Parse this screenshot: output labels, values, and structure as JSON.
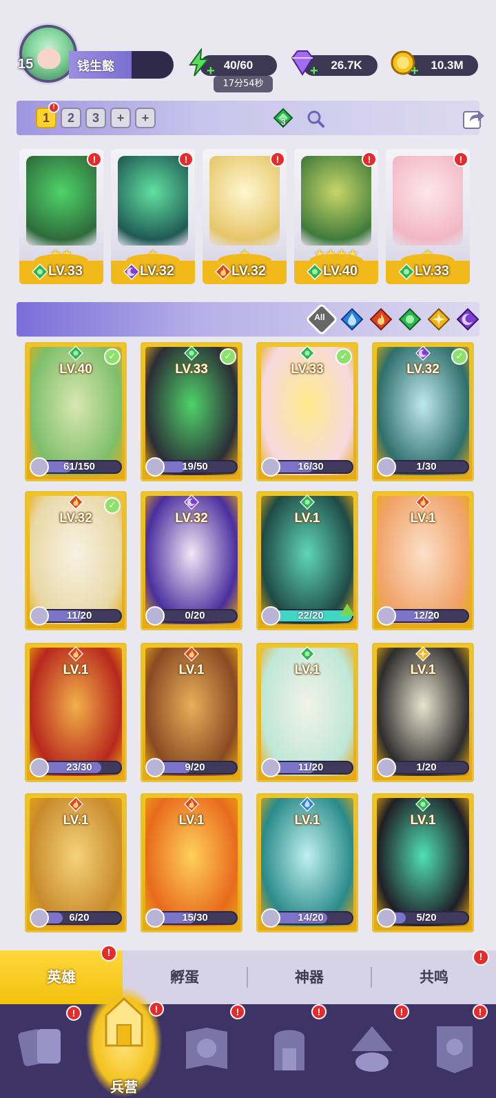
{
  "player": {
    "level": "15",
    "name": "钱生懿"
  },
  "resources": {
    "energy": "40/60",
    "energy_timer": "17分54秒",
    "gems": "26.7K",
    "coins": "10.3M"
  },
  "team_tabs": [
    "1",
    "2",
    "3",
    "+",
    "+"
  ],
  "team_gem_count": "3",
  "team_slots": [
    {
      "level": "LV.33",
      "stars": "★★",
      "element": "nature",
      "colors": [
        "#2e6b3a",
        "#4fd36a"
      ],
      "alert": "!"
    },
    {
      "level": "LV.32",
      "stars": "★",
      "element": "dark",
      "colors": [
        "#1f5a54",
        "#62e0a0"
      ],
      "alert": "!"
    },
    {
      "level": "LV.32",
      "stars": "★",
      "element": "fire",
      "colors": [
        "#e6c66a",
        "#fff6cf"
      ],
      "alert": "!"
    },
    {
      "level": "LV.40",
      "stars": "★★★★",
      "element": "nature",
      "colors": [
        "#3f7a3a",
        "#c8d66a"
      ],
      "alert": "!"
    },
    {
      "level": "LV.33",
      "stars": "★",
      "element": "nature",
      "colors": [
        "#f2b6c4",
        "#fde6ea"
      ],
      "alert": "!"
    }
  ],
  "filter_all_label": "All",
  "filters": [
    "water",
    "fire",
    "nature",
    "light",
    "dark"
  ],
  "heroes": [
    {
      "level": "LV.40",
      "shards": "61/150",
      "fill": 0.41,
      "element": "nature",
      "check": true,
      "colors": [
        "#7fbf6a",
        "#d8e7b2"
      ]
    },
    {
      "level": "LV.33",
      "shards": "19/50",
      "fill": 0.38,
      "element": "nature",
      "check": true,
      "colors": [
        "#2b2e36",
        "#4fd36a"
      ]
    },
    {
      "level": "LV.33",
      "shards": "16/30",
      "fill": 0.53,
      "element": "nature",
      "check": true,
      "colors": [
        "#f6d9e0",
        "#ffe98a"
      ]
    },
    {
      "level": "LV.32",
      "shards": "1/30",
      "fill": 0.03,
      "element": "dark",
      "check": true,
      "colors": [
        "#2f6f6a",
        "#bfe7ef"
      ]
    },
    {
      "level": "LV.32",
      "shards": "11/20",
      "fill": 0.55,
      "element": "fire",
      "check": true,
      "colors": [
        "#e9d9a8",
        "#f7f1e2"
      ]
    },
    {
      "level": "LV.32",
      "shards": "0/20",
      "fill": 0.0,
      "element": "dark",
      "check": false,
      "colors": [
        "#4a2f9e",
        "#f2e6f6"
      ]
    },
    {
      "level": "LV.1",
      "shards": "22/20",
      "fill": 1.0,
      "element": "nature",
      "check": false,
      "up": true,
      "colors": [
        "#1f4a46",
        "#5fd6b8"
      ]
    },
    {
      "level": "LV.1",
      "shards": "12/20",
      "fill": 0.6,
      "element": "fire",
      "check": false,
      "colors": [
        "#f1a36a",
        "#fbe0c8"
      ]
    },
    {
      "level": "LV.1",
      "shards": "23/30",
      "fill": 0.77,
      "element": "fire",
      "check": false,
      "colors": [
        "#b8281d",
        "#f1b04a"
      ]
    },
    {
      "level": "LV.1",
      "shards": "9/20",
      "fill": 0.45,
      "element": "fire",
      "check": false,
      "colors": [
        "#8a4a23",
        "#e7b05a"
      ]
    },
    {
      "level": "LV.1",
      "shards": "11/20",
      "fill": 0.55,
      "element": "nature",
      "check": false,
      "colors": [
        "#bfe7d8",
        "#f2f2e7"
      ]
    },
    {
      "level": "LV.1",
      "shards": "1/20",
      "fill": 0.05,
      "element": "light",
      "check": false,
      "colors": [
        "#2d2d2d",
        "#e9e3cf"
      ]
    },
    {
      "level": "LV.1",
      "shards": "6/20",
      "fill": 0.3,
      "element": "fire",
      "check": false,
      "colors": [
        "#c98b2c",
        "#f5d27a"
      ]
    },
    {
      "level": "LV.1",
      "shards": "15/30",
      "fill": 0.5,
      "element": "fire",
      "check": false,
      "colors": [
        "#e86a1d",
        "#ffd05a"
      ]
    },
    {
      "level": "LV.1",
      "shards": "14/20",
      "fill": 0.7,
      "element": "water",
      "check": false,
      "colors": [
        "#2a8a8a",
        "#bff1ef"
      ]
    },
    {
      "level": "LV.1",
      "shards": "5/20",
      "fill": 0.25,
      "element": "nature",
      "check": false,
      "colors": [
        "#1f1f26",
        "#4fe0b6"
      ]
    }
  ],
  "subtabs": [
    "英雄",
    "孵蛋",
    "神器",
    "共鸣"
  ],
  "navbar": {
    "active_label": "兵营"
  },
  "colors": {
    "water": "#2a7de1",
    "fire": "#e2431d",
    "nature": "#2bb64f",
    "light": "#f2b21a",
    "dark": "#7a3fd0"
  }
}
